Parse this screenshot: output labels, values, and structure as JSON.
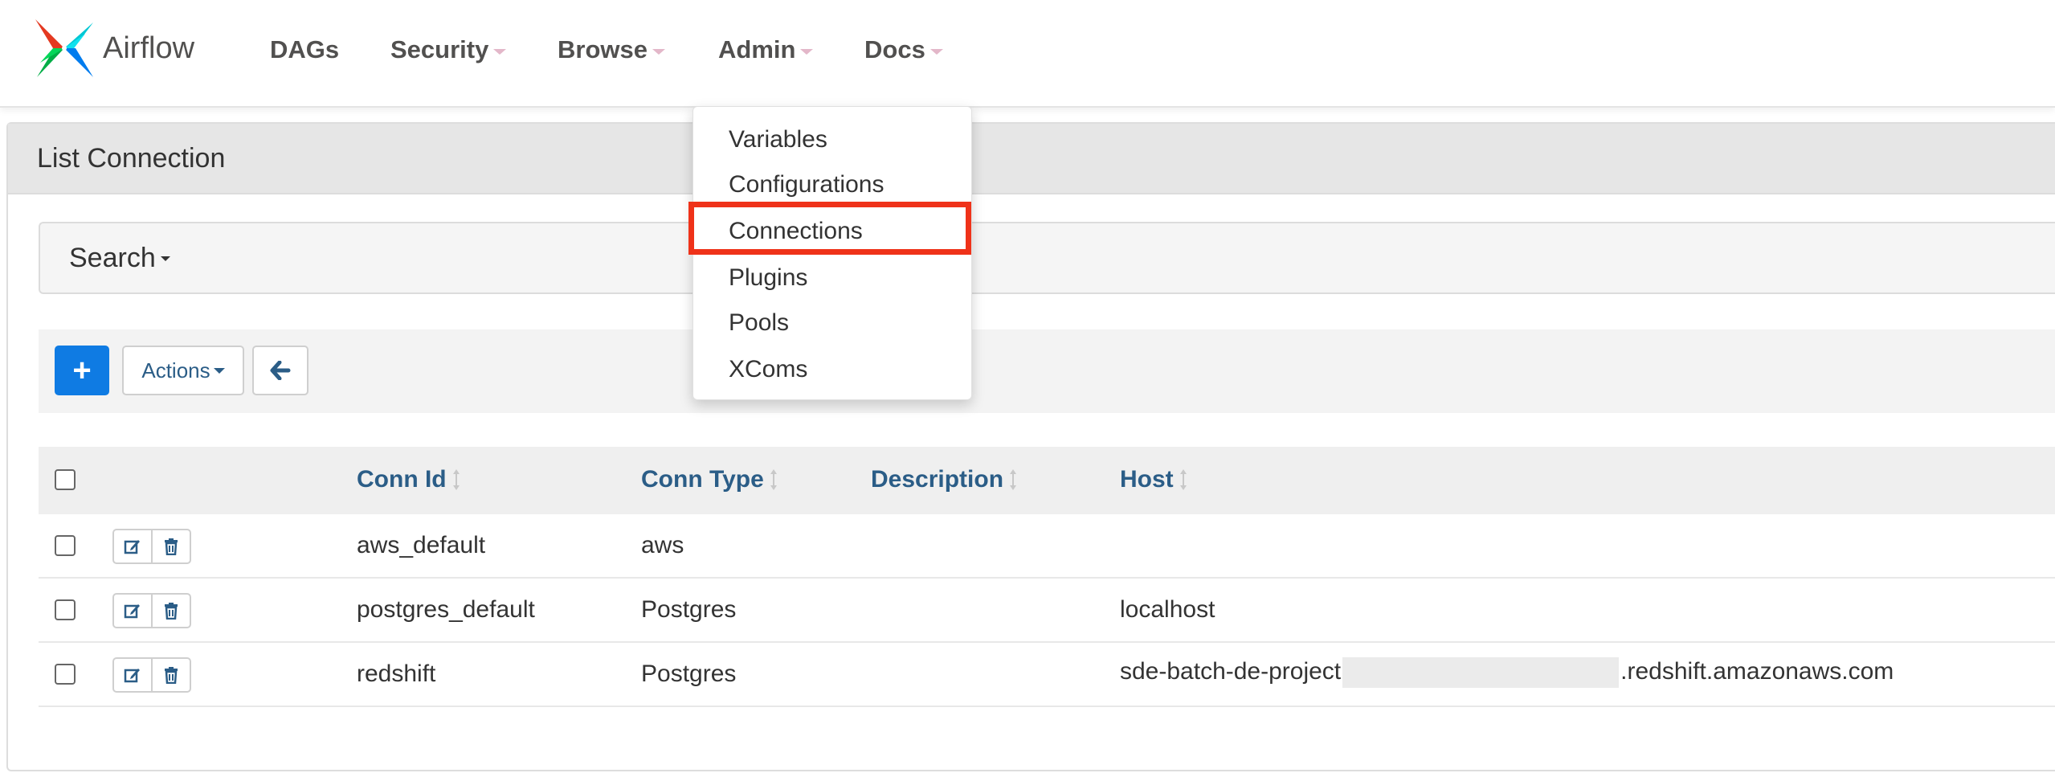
{
  "app": {
    "name": "Airflow"
  },
  "nav": {
    "dags": "DAGs",
    "security": "Security",
    "browse": "Browse",
    "admin": "Admin",
    "docs": "Docs"
  },
  "admin_menu": {
    "items": [
      "Variables",
      "Configurations",
      "Connections",
      "Plugins",
      "Pools",
      "XComs"
    ],
    "highlighted": "Connections"
  },
  "panel": {
    "title": "List Connection"
  },
  "search": {
    "label": "Search"
  },
  "toolbar": {
    "add_label": "+",
    "actions_label": "Actions"
  },
  "table": {
    "columns": [
      "Conn Id",
      "Conn Type",
      "Description",
      "Host"
    ],
    "rows": [
      {
        "conn_id": "aws_default",
        "conn_type": "aws",
        "description": "",
        "host_prefix": "",
        "host_suffix": ""
      },
      {
        "conn_id": "postgres_default",
        "conn_type": "Postgres",
        "description": "",
        "host_prefix": "localhost",
        "host_suffix": ""
      },
      {
        "conn_id": "redshift",
        "conn_type": "Postgres",
        "description": "",
        "host_prefix": "sde-batch-de-project",
        "host_suffix": ".redshift.amazonaws.com"
      }
    ]
  },
  "colors": {
    "primary_button": "#0f7be3",
    "header_link": "#2b5d87",
    "highlight_box": "#ef3219",
    "nav_caret": "#e3b7c9"
  },
  "icons": {
    "logo": "airflow-pinwheel-logo",
    "back": "arrow-left-icon",
    "edit": "edit-icon",
    "delete": "trash-icon",
    "sort": "sort-icon"
  }
}
